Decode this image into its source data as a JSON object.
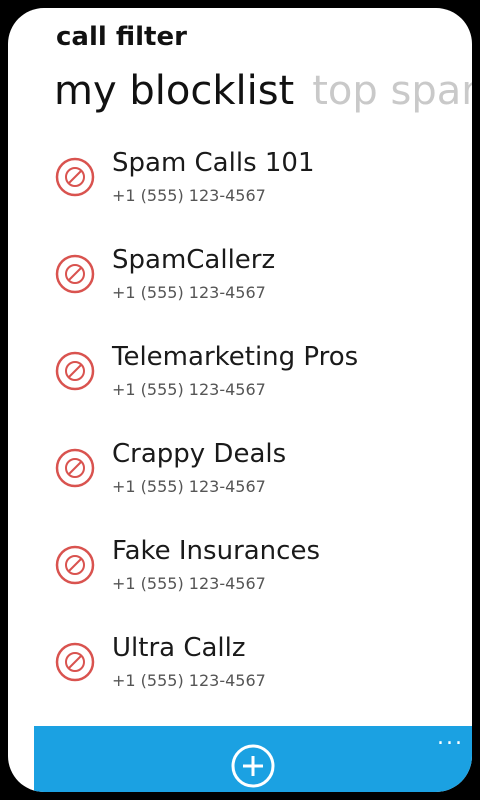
{
  "app": {
    "title": "call filter"
  },
  "pivot": {
    "active": "my blocklist",
    "next": "top spam"
  },
  "blocklist": [
    {
      "name": "Spam Calls 101",
      "phone": "+1 (555) 123-4567"
    },
    {
      "name": "SpamCallerz",
      "phone": "+1 (555) 123-4567"
    },
    {
      "name": "Telemarketing Pros",
      "phone": "+1 (555) 123-4567"
    },
    {
      "name": "Crappy Deals",
      "phone": "+1 (555) 123-4567"
    },
    {
      "name": "Fake Insurances",
      "phone": "+1 (555) 123-4567"
    },
    {
      "name": "Ultra Callz",
      "phone": "+1 (555) 123-4567"
    }
  ],
  "appbar": {
    "add_icon": "add-circle-icon",
    "more_label": "..."
  },
  "colors": {
    "accent": "#1ba1e2",
    "block_icon": "#d9534f"
  }
}
